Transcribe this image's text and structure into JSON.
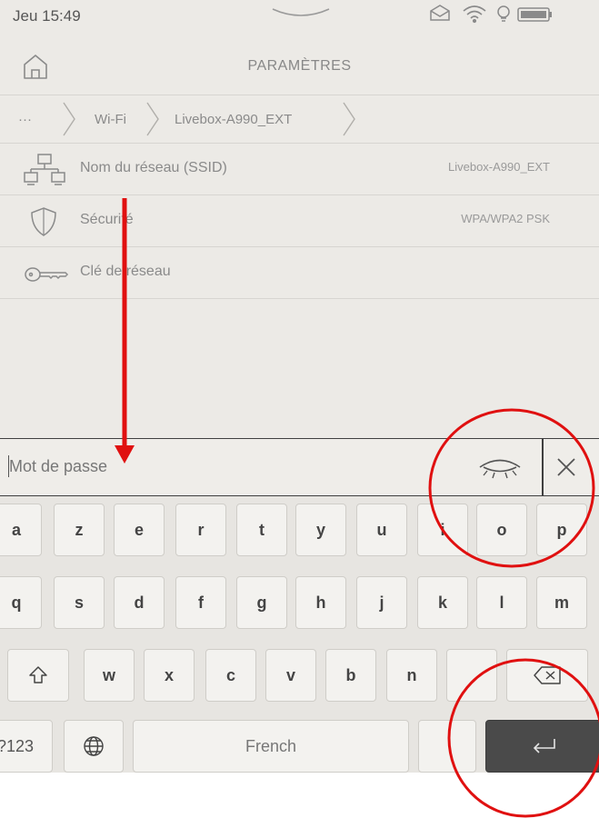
{
  "status_bar": {
    "time": "Jeu 15:49"
  },
  "header": {
    "title": "PARAMÈTRES"
  },
  "breadcrumb": {
    "items": [
      "···",
      "Wi-Fi",
      "Livebox-A990_EXT"
    ]
  },
  "rows": [
    {
      "label": "Nom du réseau (SSID)",
      "value": "Livebox-A990_EXT",
      "icon": "network-icon"
    },
    {
      "label": "Sécurité",
      "value": "WPA/WPA2 PSK",
      "icon": "shield-icon"
    },
    {
      "label": "Clé de réseau",
      "value": "",
      "icon": "key-icon"
    }
  ],
  "password": {
    "placeholder": "Mot de passe",
    "value": ""
  },
  "keyboard": {
    "row1": [
      "a",
      "z",
      "e",
      "r",
      "t",
      "y",
      "u",
      "i",
      "o",
      "p"
    ],
    "row2": [
      "q",
      "s",
      "d",
      "f",
      "g",
      "h",
      "j",
      "k",
      "l",
      "m"
    ],
    "row3": [
      "w",
      "x",
      "c",
      "v",
      "b",
      "n"
    ],
    "numbers_label": "?123",
    "space_label": "French",
    "icons": [
      "shift-icon",
      "backspace-icon",
      "globe-icon",
      "enter-icon"
    ]
  },
  "colors": {
    "annotation": "#e01010",
    "screen_bg": "#eceae6",
    "enter_key": "#4a4a4a"
  }
}
